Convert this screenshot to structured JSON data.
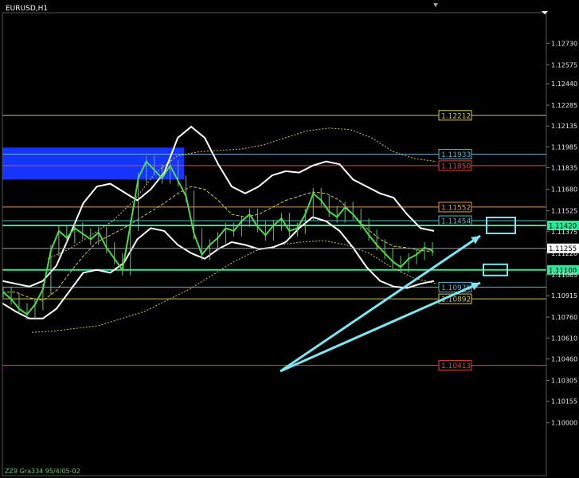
{
  "window": {
    "symbol_title": "EURUSD,H1",
    "footer_text": "ZZ9 Gra334 95/4/05-02"
  },
  "chart_data": {
    "type": "line",
    "title": "EURUSD,H1",
    "ylim": [
      1.0962,
      1.1295
    ],
    "y_ticks": [
      "1.12730",
      "1.12575",
      "1.12440",
      "1.12285",
      "1.12135",
      "1.11985",
      "1.11835",
      "1.11680",
      "1.11525",
      "1.11375",
      "1.11220",
      "1.11065",
      "1.10915",
      "1.10760",
      "1.10610",
      "1.10460",
      "1.10305",
      "1.10155",
      "1.10000"
    ],
    "current_price": "1.11255",
    "levels": [
      {
        "label": "1.12212",
        "value": 1.12212,
        "color": "#d4c74f"
      },
      {
        "label": "1.11933",
        "value": 1.11933,
        "color": "#5fb3c8"
      },
      {
        "label": "1.11850",
        "value": 1.1185,
        "color": "#e0473a"
      },
      {
        "label": "1.11552",
        "value": 1.11552,
        "color": "#e89a4e"
      },
      {
        "label": "1.11454",
        "value": 1.11454,
        "color": "#5fb3c8"
      },
      {
        "label": "1.10976",
        "value": 1.10976,
        "color": "#5fb3c8"
      },
      {
        "label": "1.10892",
        "value": 1.10892,
        "color": "#d4c74f"
      },
      {
        "label": "1.10413",
        "value": 1.10413,
        "color": "#e0473a"
      }
    ],
    "highlight_levels": [
      {
        "label": "1.11420",
        "value": 1.1142,
        "color": "#2ee89a"
      },
      {
        "label": "1.11100",
        "value": 1.111,
        "color": "#2ee89a"
      }
    ],
    "price_series": [
      1.1094,
      1.1089,
      1.1082,
      1.1078,
      1.1085,
      1.1096,
      1.1124,
      1.1138,
      1.1133,
      1.114,
      1.1136,
      1.1132,
      1.1137,
      1.1126,
      1.1118,
      1.111,
      1.1142,
      1.1176,
      1.1188,
      1.1182,
      1.1176,
      1.1185,
      1.1174,
      1.1163,
      1.1136,
      1.1121,
      1.1128,
      1.1133,
      1.114,
      1.1138,
      1.1145,
      1.115,
      1.1141,
      1.1135,
      1.1142,
      1.1147,
      1.1138,
      1.114,
      1.115,
      1.1165,
      1.116,
      1.1152,
      1.1148,
      1.1155,
      1.115,
      1.1143,
      1.1135,
      1.1128,
      1.1122,
      1.1116,
      1.1112,
      1.1118,
      1.1121,
      1.1126,
      1.1124
    ],
    "bollinger_upper": [
      1.1102,
      1.11,
      1.1098,
      1.1102,
      1.1113,
      1.1135,
      1.1158,
      1.117,
      1.1172,
      1.1166,
      1.116,
      1.1168,
      1.118,
      1.1205,
      1.1213,
      1.1205,
      1.1186,
      1.117,
      1.1165,
      1.117,
      1.1178,
      1.1181,
      1.118,
      1.1185,
      1.1188,
      1.1186,
      1.1175,
      1.117,
      1.1165,
      1.1162,
      1.115,
      1.114,
      1.1138
    ],
    "bollinger_middle": [
      1.1094,
      1.1094,
      1.109,
      1.1088,
      1.1095,
      1.1108,
      1.112,
      1.113,
      1.1135,
      1.114,
      1.1146,
      1.1152,
      1.1158,
      1.1165,
      1.117,
      1.1168,
      1.116,
      1.115,
      1.1148,
      1.115,
      1.1155,
      1.116,
      1.1163,
      1.1166,
      1.1165,
      1.116,
      1.115,
      1.114,
      1.1132,
      1.1127,
      1.1126,
      1.1124,
      1.1123
    ],
    "bollinger_lower": [
      1.1086,
      1.108,
      1.1075,
      1.1075,
      1.1082,
      1.1095,
      1.1108,
      1.111,
      1.1108,
      1.1115,
      1.1132,
      1.114,
      1.1138,
      1.1128,
      1.1122,
      1.1118,
      1.1125,
      1.113,
      1.1128,
      1.1125,
      1.1126,
      1.113,
      1.114,
      1.1148,
      1.1145,
      1.1138,
      1.1126,
      1.1112,
      1.1102,
      1.1098,
      1.1097,
      1.11,
      1.1102
    ],
    "envelope_upper": [
      1.1118,
      1.1125,
      1.1135,
      1.1145,
      1.116,
      1.118,
      1.1192,
      1.1195,
      1.1196,
      1.1197,
      1.12,
      1.1205,
      1.121,
      1.1212,
      1.1211,
      1.1205,
      1.1195,
      1.119,
      1.1188
    ],
    "envelope_lower": [
      1.1065,
      1.1066,
      1.1068,
      1.107,
      1.1075,
      1.108,
      1.1088,
      1.1096,
      1.1106,
      1.1116,
      1.1124,
      1.1128,
      1.113,
      1.1131,
      1.1128,
      1.1122,
      1.1112,
      1.1104,
      1.11
    ],
    "supply_zone": {
      "from": 1.1175,
      "to": 1.1198
    },
    "target_boxes": [
      "1.11420",
      "1.11100"
    ],
    "legend": "none",
    "grid": false
  }
}
